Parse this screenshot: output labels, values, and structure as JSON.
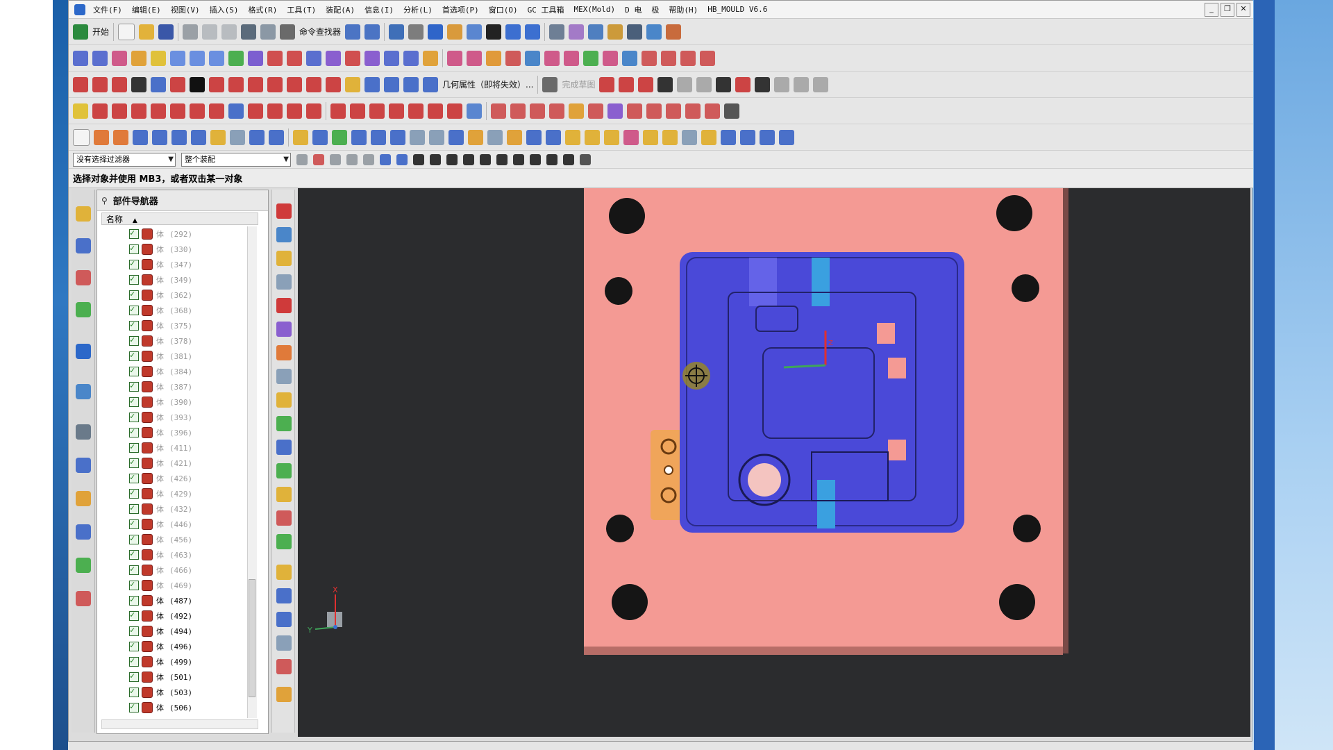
{
  "menubar": {
    "items": [
      "文件(F)",
      "编辑(E)",
      "视图(V)",
      "插入(S)",
      "格式(R)",
      "工具(T)",
      "装配(A)",
      "信息(I)",
      "分析(L)",
      "首选项(P)",
      "窗口(O)",
      "GC 工具箱",
      "MEX(Mold)",
      "D 电",
      "极",
      "帮助(H)",
      "HB_MOULD V6.6"
    ]
  },
  "toolbar": {
    "start_label": "开始",
    "command_finder_label": "命令查找器",
    "geometry_label": "几何属性（即将失效）...",
    "finish_sketch_label": "完成草图"
  },
  "selection": {
    "filter_value": "没有选择过滤器",
    "scope_value": "整个装配"
  },
  "status": {
    "prompt": "选择对象并使用 MB3，或者双击某一对象"
  },
  "navigator": {
    "title": "部件导航器",
    "column_header": "名称",
    "rows": [
      {
        "type": "体",
        "id": "(292)"
      },
      {
        "type": "体",
        "id": "(330)"
      },
      {
        "type": "体",
        "id": "(347)"
      },
      {
        "type": "体",
        "id": "(349)"
      },
      {
        "type": "体",
        "id": "(362)"
      },
      {
        "type": "体",
        "id": "(368)"
      },
      {
        "type": "体",
        "id": "(375)"
      },
      {
        "type": "体",
        "id": "(378)"
      },
      {
        "type": "体",
        "id": "(381)"
      },
      {
        "type": "体",
        "id": "(384)"
      },
      {
        "type": "体",
        "id": "(387)"
      },
      {
        "type": "体",
        "id": "(390)"
      },
      {
        "type": "体",
        "id": "(393)"
      },
      {
        "type": "体",
        "id": "(396)"
      },
      {
        "type": "体",
        "id": "(411)"
      },
      {
        "type": "体",
        "id": "(421)"
      },
      {
        "type": "体",
        "id": "(426)"
      },
      {
        "type": "体",
        "id": "(429)"
      },
      {
        "type": "体",
        "id": "(432)"
      },
      {
        "type": "体",
        "id": "(446)"
      },
      {
        "type": "体",
        "id": "(456)"
      },
      {
        "type": "体",
        "id": "(463)"
      },
      {
        "type": "体",
        "id": "(466)"
      },
      {
        "type": "体",
        "id": "(469)"
      },
      {
        "type": "体",
        "id": "(487)"
      },
      {
        "type": "体",
        "id": "(492)"
      },
      {
        "type": "体",
        "id": "(494)"
      },
      {
        "type": "体",
        "id": "(496)"
      },
      {
        "type": "体",
        "id": "(499)"
      },
      {
        "type": "体",
        "id": "(501)"
      },
      {
        "type": "体",
        "id": "(503)"
      },
      {
        "type": "体",
        "id": "(506)"
      }
    ],
    "dark_from": 24
  },
  "viewport": {
    "triad": {
      "x": "X",
      "y": "Y",
      "z": "Z"
    },
    "colors": {
      "background": "#2b2c2e",
      "plate": "#f49a94",
      "cavity": "#4a49d8",
      "slider": "#f0a55a",
      "hole": "#1a1a1a"
    }
  }
}
